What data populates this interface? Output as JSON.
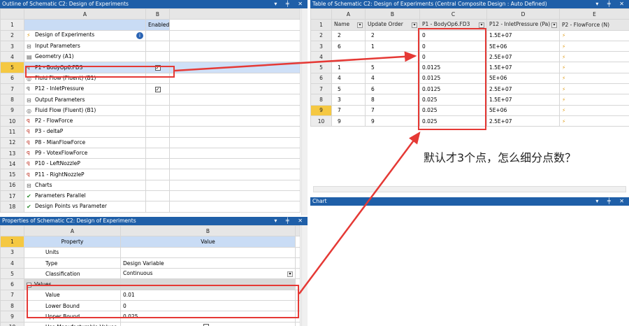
{
  "outline": {
    "title": "Outline of Schematic C2: Design of Experiments",
    "col_a": "A",
    "col_b": "B",
    "enabled_label": "Enabled",
    "rows": [
      {
        "n": "1",
        "text": "",
        "level": 0
      },
      {
        "n": "2",
        "text": "Design of Experiments",
        "level": 1
      },
      {
        "n": "3",
        "text": "Input Parameters",
        "level": 2
      },
      {
        "n": "4",
        "text": "Geometry (A1)",
        "level": 3
      },
      {
        "n": "5",
        "text": "P1 - BodyOp6.FD3",
        "level": 4
      },
      {
        "n": "6",
        "text": "Fluid Flow (Fluent) (B1)",
        "level": 3
      },
      {
        "n": "7",
        "text": "P12 - InletPressure",
        "level": 4
      },
      {
        "n": "8",
        "text": "Output Parameters",
        "level": 2
      },
      {
        "n": "9",
        "text": "Fluid Flow (Fluent) (B1)",
        "level": 3
      },
      {
        "n": "10",
        "text": "P2 - FlowForce",
        "level": 4
      },
      {
        "n": "11",
        "text": "P3 - deltaP",
        "level": 4
      },
      {
        "n": "12",
        "text": "P8 - MianFlowForce",
        "level": 4
      },
      {
        "n": "13",
        "text": "P9 - VotexFlowForce",
        "level": 4
      },
      {
        "n": "14",
        "text": "P10 - LeftNozzleP",
        "level": 4
      },
      {
        "n": "15",
        "text": "P11 - RightNozzleP",
        "level": 4
      },
      {
        "n": "16",
        "text": "Charts",
        "level": 2
      },
      {
        "n": "17",
        "text": "Parameters Parallel",
        "level": 3
      },
      {
        "n": "18",
        "text": "Design Points vs Parameter",
        "level": 3
      }
    ]
  },
  "properties": {
    "title": "Properties of Schematic C2: Design of Experiments",
    "col_a": "A",
    "col_b": "B",
    "header_property": "Property",
    "header_value": "Value",
    "rows": [
      {
        "n": "1",
        "prop": "Property",
        "val": "Value"
      },
      {
        "n": "3",
        "prop": "Units",
        "val": ""
      },
      {
        "n": "4",
        "prop": "Type",
        "val": "Design Variable"
      },
      {
        "n": "5",
        "prop": "Classification",
        "val": "Continuous"
      },
      {
        "n": "6",
        "prop": "Values",
        "val": ""
      },
      {
        "n": "7",
        "prop": "Value",
        "val": "0.01"
      },
      {
        "n": "8",
        "prop": "Lower Bound",
        "val": "0"
      },
      {
        "n": "9",
        "prop": "Upper Bound",
        "val": "0.025"
      },
      {
        "n": "10",
        "prop": "Use Manufacturable Values",
        "val": ""
      }
    ]
  },
  "table": {
    "title": "Table of Schematic C2: Design of Experiments (Central Composite Design : Auto Defined)",
    "cols": [
      "A",
      "B",
      "C",
      "D",
      "E"
    ],
    "headers": [
      "Name",
      "Update Order",
      "P1 - BodyOp6.FD3",
      "P12 - InletPressure (Pa)",
      "P2 - FlowForce (N)"
    ],
    "rows": [
      {
        "n": "2",
        "name": "2",
        "order": "2",
        "p1": "0",
        "p12": "1.5E+07"
      },
      {
        "n": "3",
        "name": "6",
        "order": "1",
        "p1": "0",
        "p12": "5E+06"
      },
      {
        "n": "4",
        "name": "",
        "order": "",
        "p1": "0",
        "p12": "2.5E+07"
      },
      {
        "n": "5",
        "name": "1",
        "order": "5",
        "p1": "0.0125",
        "p12": "1.5E+07"
      },
      {
        "n": "6",
        "name": "4",
        "order": "4",
        "p1": "0.0125",
        "p12": "5E+06"
      },
      {
        "n": "7",
        "name": "5",
        "order": "6",
        "p1": "0.0125",
        "p12": "2.5E+07"
      },
      {
        "n": "8",
        "name": "3",
        "order": "8",
        "p1": "0.025",
        "p12": "1.5E+07"
      },
      {
        "n": "9",
        "name": "7",
        "order": "7",
        "p1": "0.025",
        "p12": "5E+06"
      },
      {
        "n": "10",
        "name": "9",
        "order": "9",
        "p1": "0.025",
        "p12": "2.5E+07"
      }
    ]
  },
  "chart": {
    "title": "Chart"
  },
  "annotation": {
    "text": "默认才3个点，怎么细分点数？",
    "color": "#e53935"
  },
  "window_controls": "▾ ╪ ✕"
}
